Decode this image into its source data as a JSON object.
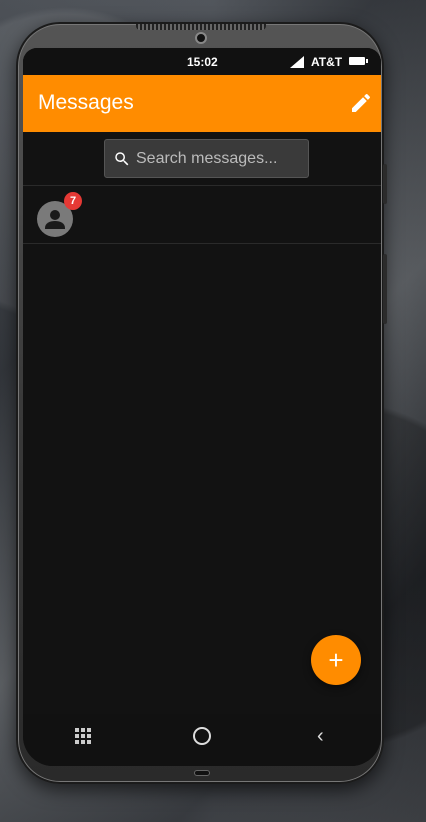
{
  "status_bar": {
    "time": "15:02",
    "carrier": "AT&T",
    "signal_icon": "signal-icon",
    "battery_icon": "battery-icon"
  },
  "app_bar": {
    "title": "Messages",
    "edit_icon": "pencil-icon"
  },
  "search": {
    "placeholder": "Search messages..."
  },
  "conversations": [
    {
      "avatar_icon": "person-icon",
      "unread_count": "7"
    }
  ],
  "fab": {
    "label": "+"
  },
  "nav_bar": {
    "apps_icon": "grid-icon",
    "home_icon": "circle-icon",
    "back_label": "‹"
  },
  "colors": {
    "accent": "#ff8c00",
    "badge": "#e53935",
    "background": "#121212"
  }
}
